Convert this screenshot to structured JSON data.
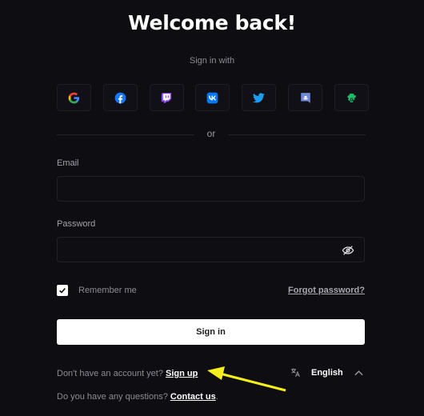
{
  "header": {
    "title": "Welcome back!",
    "subtitle": "Sign in with"
  },
  "social_providers": [
    {
      "name": "Google",
      "icon": "google-icon"
    },
    {
      "name": "Facebook",
      "icon": "facebook-icon"
    },
    {
      "name": "Twitch",
      "icon": "twitch-icon"
    },
    {
      "name": "VK",
      "icon": "vk-icon"
    },
    {
      "name": "Twitter",
      "icon": "twitter-icon"
    },
    {
      "name": "Discord",
      "icon": "discord-icon"
    },
    {
      "name": "Guilded",
      "icon": "guilded-icon"
    }
  ],
  "divider_text": "or",
  "form": {
    "email_label": "Email",
    "email_value": "",
    "password_label": "Password",
    "password_value": "",
    "password_toggle_icon": "eye-slash-icon",
    "remember_label": "Remember me",
    "remember_checked": true,
    "forgot_label": "Forgot password?",
    "submit_label": "Sign in"
  },
  "footer": {
    "signup_prompt": "Don't have an account yet?",
    "signup_link": "Sign up",
    "contact_prompt": "Do you have any questions?",
    "contact_link": "Contact us",
    "contact_suffix": ".",
    "language": "English",
    "language_icon": "translate-icon"
  },
  "annotation": {
    "color": "#f5ee1e",
    "icon": "arrow-pointer-annotation"
  },
  "colors": {
    "background": "#0e0d12",
    "primary_button": "#ffffff",
    "google": "#4285f4",
    "facebook": "#1877f2",
    "twitch": "#9146ff",
    "vk": "#0077ff",
    "twitter": "#1d9bf0",
    "discord": "#7289da",
    "guilded": "#1fbe6a"
  }
}
